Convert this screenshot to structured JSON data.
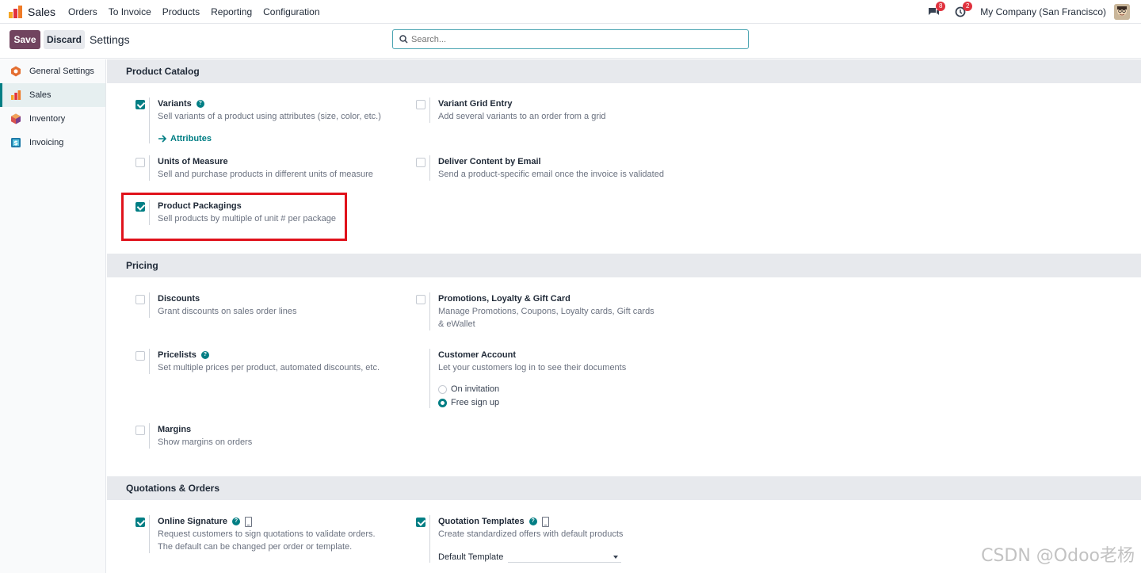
{
  "app": {
    "name": "Sales",
    "menu": [
      "Orders",
      "To Invoice",
      "Products",
      "Reporting",
      "Configuration"
    ],
    "company": "My Company (San Francisco)",
    "messages_badge": "8",
    "activities_badge": "2"
  },
  "control": {
    "save_label": "Save",
    "discard_label": "Discard",
    "title": "Settings",
    "search_placeholder": "Search..."
  },
  "sidebar": {
    "items": [
      {
        "label": "General Settings",
        "icon": "general-settings-icon"
      },
      {
        "label": "Sales",
        "icon": "sales-app-icon",
        "active": true
      },
      {
        "label": "Inventory",
        "icon": "inventory-app-icon"
      },
      {
        "label": "Invoicing",
        "icon": "invoicing-app-icon"
      }
    ]
  },
  "sections": {
    "product_catalog": {
      "title": "Product Catalog",
      "variants": {
        "title": "Variants",
        "desc": "Sell variants of a product using attributes (size, color, etc.)",
        "checked": true,
        "link": "Attributes"
      },
      "variant_grid": {
        "title": "Variant Grid Entry",
        "desc": "Add several variants to an order from a grid",
        "checked": false
      },
      "uom": {
        "title": "Units of Measure",
        "desc": "Sell and purchase products in different units of measure",
        "checked": false
      },
      "deliver_content": {
        "title": "Deliver Content by Email",
        "desc": "Send a product-specific email once the invoice is validated",
        "checked": false
      },
      "packagings": {
        "title": "Product Packagings",
        "desc": "Sell products by multiple of unit # per package",
        "checked": true
      }
    },
    "pricing": {
      "title": "Pricing",
      "discounts": {
        "title": "Discounts",
        "desc": "Grant discounts on sales order lines",
        "checked": false
      },
      "promotions": {
        "title": "Promotions, Loyalty & Gift Card",
        "desc": "Manage Promotions, Coupons, Loyalty cards, Gift cards & eWallet",
        "checked": false
      },
      "pricelists": {
        "title": "Pricelists",
        "desc": "Set multiple prices per product, automated discounts, etc.",
        "checked": false
      },
      "customer_account": {
        "title": "Customer Account",
        "desc": "Let your customers log in to see their documents",
        "option_invitation": "On invitation",
        "option_signup": "Free sign up",
        "selected": "Free sign up"
      },
      "margins": {
        "title": "Margins",
        "desc": "Show margins on orders",
        "checked": false
      }
    },
    "quotations": {
      "title": "Quotations & Orders",
      "online_signature": {
        "title": "Online Signature",
        "desc": "Request customers to sign quotations to validate orders. The default can be changed per order or template.",
        "checked": true
      },
      "quotation_templates": {
        "title": "Quotation Templates",
        "desc": "Create standardized offers with default products",
        "checked": true,
        "default_label": "Default Template"
      }
    }
  },
  "watermark": "CSDN @Odoo老杨",
  "colors": {
    "accent": "#017e84",
    "primary": "#71445f",
    "highlight": "#e0121b"
  }
}
